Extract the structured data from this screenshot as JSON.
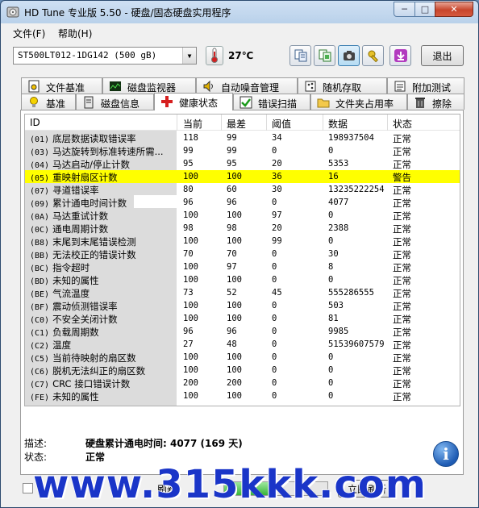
{
  "window": {
    "title": "HD Tune 专业版 5.50 - 硬盘/固态硬盘实用程序",
    "minimize": "─",
    "maximize": "□",
    "close": "✕"
  },
  "menu": {
    "items": [
      "文件(F)",
      "帮助(H)"
    ]
  },
  "toolbar": {
    "drive": "ST500LT012-1DG142 (500 gB)",
    "temperature": "27℃",
    "exit_label": "退出",
    "icons": [
      "copy-text-icon",
      "copy-info-icon",
      "screenshot-icon",
      "options-icon",
      "save-icon"
    ]
  },
  "tabs": {
    "top": [
      "文件基准",
      "磁盘监视器",
      "自动噪音管理",
      "随机存取",
      "附加测试"
    ],
    "bottom": [
      "基准",
      "磁盘信息",
      "健康状态",
      "错误扫描",
      "文件夹占用率",
      "擦除"
    ],
    "selected": "健康状态"
  },
  "table": {
    "headers": [
      "ID",
      "当前",
      "最差",
      "阈值",
      "数据",
      "状态"
    ],
    "rows": [
      {
        "code": "(01)",
        "name": "底层数据读取错误率",
        "current": "118",
        "worst": "99",
        "threshold": "34",
        "data": "198937504",
        "status": "正常"
      },
      {
        "code": "(03)",
        "name": "马达旋转到标准转速所需...",
        "current": "99",
        "worst": "99",
        "threshold": "0",
        "data": "0",
        "status": "正常"
      },
      {
        "code": "(04)",
        "name": "马达启动/停止计数",
        "current": "95",
        "worst": "95",
        "threshold": "20",
        "data": "5353",
        "status": "正常"
      },
      {
        "code": "(05)",
        "name": "重映射扇区计数",
        "current": "100",
        "worst": "100",
        "threshold": "36",
        "data": "16",
        "status": "警告",
        "warn": true
      },
      {
        "code": "(07)",
        "name": "寻道错误率",
        "current": "80",
        "worst": "60",
        "threshold": "30",
        "data": "13235222254",
        "status": "正常"
      },
      {
        "code": "(09)",
        "name": "累计通电时间计数",
        "current": "96",
        "worst": "96",
        "threshold": "0",
        "data": "4077",
        "status": "正常"
      },
      {
        "code": "(0A)",
        "name": "马达重试计数",
        "current": "100",
        "worst": "100",
        "threshold": "97",
        "data": "0",
        "status": "正常"
      },
      {
        "code": "(0C)",
        "name": "通电周期计数",
        "current": "98",
        "worst": "98",
        "threshold": "20",
        "data": "2388",
        "status": "正常"
      },
      {
        "code": "(B8)",
        "name": "末尾到末尾错误检测",
        "current": "100",
        "worst": "100",
        "threshold": "99",
        "data": "0",
        "status": "正常"
      },
      {
        "code": "(BB)",
        "name": "无法校正的错误计数",
        "current": "70",
        "worst": "70",
        "threshold": "0",
        "data": "30",
        "status": "正常"
      },
      {
        "code": "(BC)",
        "name": "指令超时",
        "current": "100",
        "worst": "97",
        "threshold": "0",
        "data": "8",
        "status": "正常"
      },
      {
        "code": "(BD)",
        "name": "未知的属性",
        "current": "100",
        "worst": "100",
        "threshold": "0",
        "data": "0",
        "status": "正常"
      },
      {
        "code": "(BE)",
        "name": "气流温度",
        "current": "73",
        "worst": "52",
        "threshold": "45",
        "data": "555286555",
        "status": "正常"
      },
      {
        "code": "(BF)",
        "name": "震动侦测错误率",
        "current": "100",
        "worst": "100",
        "threshold": "0",
        "data": "503",
        "status": "正常"
      },
      {
        "code": "(C0)",
        "name": "不安全关闭计数",
        "current": "100",
        "worst": "100",
        "threshold": "0",
        "data": "81",
        "status": "正常"
      },
      {
        "code": "(C1)",
        "name": "负载周期数",
        "current": "96",
        "worst": "96",
        "threshold": "0",
        "data": "9985",
        "status": "正常"
      },
      {
        "code": "(C2)",
        "name": "温度",
        "current": "27",
        "worst": "48",
        "threshold": "0",
        "data": "51539607579",
        "status": "正常"
      },
      {
        "code": "(C5)",
        "name": "当前待映射的扇区数",
        "current": "100",
        "worst": "100",
        "threshold": "0",
        "data": "0",
        "status": "正常"
      },
      {
        "code": "(C6)",
        "name": "脱机无法纠正的扇区数",
        "current": "100",
        "worst": "100",
        "threshold": "0",
        "data": "0",
        "status": "正常"
      },
      {
        "code": "(C7)",
        "name": "CRC 接口错误计数",
        "current": "200",
        "worst": "200",
        "threshold": "0",
        "data": "0",
        "status": "正常"
      },
      {
        "code": "(FE)",
        "name": "未知的属性",
        "current": "100",
        "worst": "100",
        "threshold": "0",
        "data": "0",
        "status": "正常"
      }
    ]
  },
  "details": {
    "desc_label": "描述:",
    "desc_value": "硬盘累计通电时间: 4077 (169 天)",
    "status_label": "状态:",
    "status_value": "正常"
  },
  "statusbar": {
    "refresh_label": "刷新",
    "refresh_button": "立即刷新",
    "progress": 0.45
  },
  "colors": {
    "warn_row": "#ffff00",
    "accent": "#1a35c8"
  },
  "watermark": "www.315kkk.com"
}
